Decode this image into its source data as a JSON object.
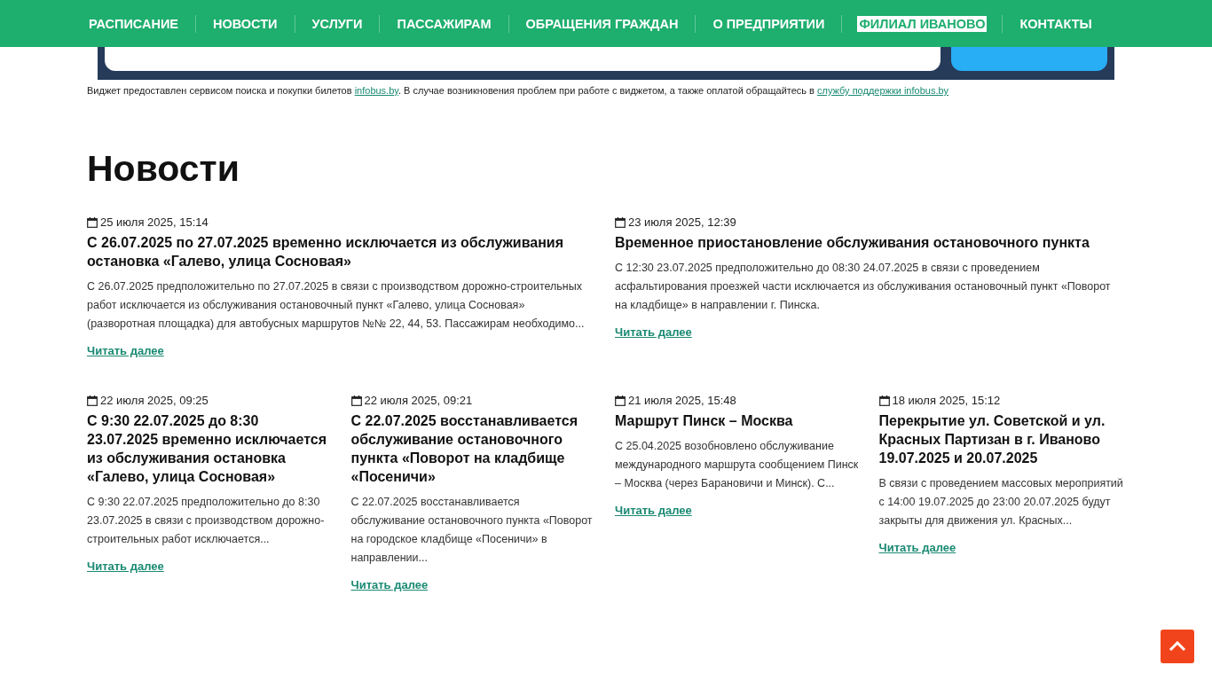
{
  "nav": [
    {
      "label": "РАСПИСАНИЕ",
      "selected": false
    },
    {
      "label": "НОВОСТИ",
      "selected": false
    },
    {
      "label": "УСЛУГИ",
      "selected": false
    },
    {
      "label": "ПАССАЖИРАМ",
      "selected": false
    },
    {
      "label": "ОБРАЩЕНИЯ ГРАЖДАН",
      "selected": false
    },
    {
      "label": "О ПРЕДПРИЯТИИ",
      "selected": false
    },
    {
      "label": "ФИЛИАЛ ИВАНОВО",
      "selected": true
    },
    {
      "label": "КОНТАКТЫ",
      "selected": false
    }
  ],
  "widget_note": [
    {
      "kind": "text",
      "text": "Виджет предоставлен сервисом поиска и покупки билетов "
    },
    {
      "kind": "link",
      "text": "infobus.by"
    },
    {
      "kind": "text",
      "text": ". В случае возникновения проблем при работе с виджетом, а также оплатой обращайтесь в "
    },
    {
      "kind": "link",
      "text": "службу поддержки infobus.by"
    }
  ],
  "heading": "Новости",
  "news": [
    {
      "wide": true,
      "date": "25 июля 2025, 15:14",
      "title": "С 26.07.2025 по 27.07.2025 временно исключается из обслуживания остановка «Галево, улица Сосновая»",
      "excerpt": "С 26.07.2025 предположительно по 27.07.2025 в связи с производством дорожно-строительных работ исключается из обслуживания остановочный пункт «Галево, улица Сосновая» (разворотная площадка) для автобусных маршрутов №№ 22, 44, 53. Пассажирам необходимо...",
      "link": "Читать далее"
    },
    {
      "wide": true,
      "date": "23 июля 2025, 12:39",
      "title": "Временное приостановление обслуживания остановочного пункта",
      "excerpt": "С 12:30 23.07.2025 предположительно до 08:30 24.07.2025 в связи с проведением асфальтирования проезжей части исключается из обслуживания остановочный пункт «Поворот на кладбище» в направлении г. Пинска.",
      "link": "Читать далее"
    },
    {
      "wide": false,
      "date": "22 июля 2025, 09:25",
      "title": "С 9:30 22.07.2025 до 8:30 23.07.2025 временно исключается из обслуживания остановка «Галево, улица Сосновая»",
      "excerpt": "С 9:30 22.07.2025 предположительно до 8:30 23.07.2025 в связи с производством дорожно-строительных работ исключается...",
      "link": "Читать далее"
    },
    {
      "wide": false,
      "date": "22 июля 2025, 09:21",
      "title": "С 22.07.2025 восстанавливается обслуживание остановочного пункта «Поворот на кладбище «Посеничи»",
      "excerpt": "С 22.07.2025 восстанавливается обслуживание остановочного пункта «Поворот на городское кладбище «Посеничи» в направлении...",
      "link": "Читать далее"
    },
    {
      "wide": false,
      "date": "21 июля 2025, 15:48",
      "title": "Маршрут Пинск – Москва",
      "excerpt": "С 25.04.2025 возобновлено обслуживание международного маршрута сообщением Пинск – Москва (через Барановичи и Минск). С...",
      "link": "Читать далее"
    },
    {
      "wide": false,
      "date": "18 июля 2025, 15:12",
      "title": "Перекрытие ул. Советской и ул. Красных Партизан в г. Иваново 19.07.2025 и 20.07.2025",
      "excerpt": "В связи с проведением массовых мероприятий с 14:00 19.07.2025 до 23:00 20.07.2025 будут закрыты для движения ул. Красных...",
      "link": "Читать далее"
    }
  ]
}
